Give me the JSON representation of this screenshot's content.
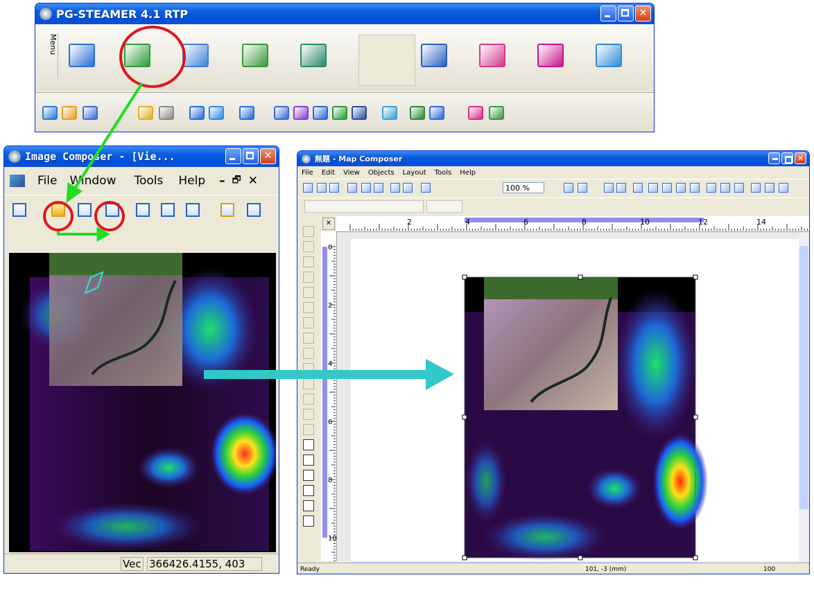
{
  "steamer": {
    "title": "PG-STEAMER 4.1 RTP",
    "menu_label": "Menu",
    "big_icons": [
      "table-icon",
      "map-window-icon",
      "vector-icon",
      "layers-icon",
      "legend-icon",
      "settings-gear-icon",
      "network-icon",
      "magic-grid-icon",
      "help-book-icon",
      "exit-door-icon"
    ],
    "small_icons": [
      "gps-icon",
      "folder-icon",
      "stack-icon",
      "help-icon",
      "info-icon",
      "copy-icon",
      "split-icon",
      "import-icon",
      "frame-icon",
      "resize-icon",
      "rotate-icon",
      "globe-icon",
      "calculator-icon",
      "palette-icon",
      "layer-icon",
      "image-icon",
      "draw-icon",
      "chart-icon"
    ]
  },
  "image_composer": {
    "title": "Image Composer - [Vie...",
    "menu": [
      "File",
      "Window",
      "Tools",
      "Help"
    ],
    "status_left": "Vec",
    "status_coords": "366426.4155, 403"
  },
  "map_composer": {
    "title": "無題 - Map Composer",
    "menu": [
      "File",
      "Edit",
      "View",
      "Objects",
      "Layout",
      "Tools",
      "Help"
    ],
    "zoom": "100 %",
    "ruler_ticks": [
      "2",
      "4",
      "6",
      "8",
      "10",
      "12",
      "14"
    ],
    "vruler_ticks": [
      "0",
      "2",
      "4",
      "6",
      "8",
      "10"
    ],
    "status_ready": "Ready",
    "status_coords": "101, -3 (mm)",
    "status_zoom": "100"
  },
  "colors": {
    "annotation_red": "#e1141c",
    "arrow_green": "#22dd22",
    "arrow_teal": "#33c8c8",
    "xp_blue": "#0a5bdb"
  }
}
